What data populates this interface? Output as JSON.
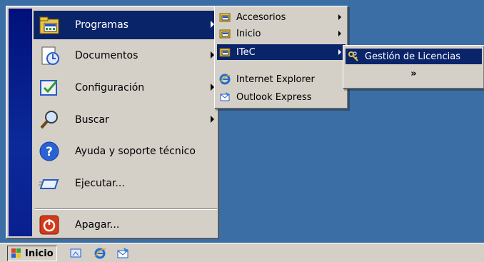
{
  "start_menu": {
    "items": [
      {
        "label": "Programas",
        "icon": "programs-folder-icon",
        "has_submenu": true,
        "selected": true
      },
      {
        "label": "Documentos",
        "icon": "documents-icon",
        "has_submenu": true
      },
      {
        "label": "Configuración",
        "icon": "settings-icon",
        "has_submenu": true
      },
      {
        "label": "Buscar",
        "icon": "search-icon",
        "has_submenu": true
      },
      {
        "label": "Ayuda y soporte técnico",
        "icon": "help-icon",
        "has_submenu": false
      },
      {
        "label": "Ejecutar...",
        "icon": "run-icon",
        "has_submenu": false
      },
      {
        "label": "Apagar...",
        "icon": "shutdown-icon",
        "has_submenu": false
      }
    ]
  },
  "programs_menu": {
    "items": [
      {
        "label": "Accesorios",
        "icon": "program-group-icon",
        "has_submenu": true
      },
      {
        "label": "Inicio",
        "icon": "program-group-icon",
        "has_submenu": true
      },
      {
        "label": "ITeC",
        "icon": "program-group-icon",
        "has_submenu": true,
        "selected": true
      },
      {
        "label": "Internet Explorer",
        "icon": "internet-explorer-icon",
        "has_submenu": false
      },
      {
        "label": "Outlook Express",
        "icon": "outlook-express-icon",
        "has_submenu": false
      }
    ]
  },
  "itec_menu": {
    "items": [
      {
        "label": "Gestión de Licencias",
        "icon": "keys-icon",
        "selected": true
      }
    ],
    "expand_glyph": "»"
  },
  "taskbar": {
    "start_label": "Inicio",
    "quick_launch": [
      "show-desktop-icon",
      "internet-explorer-icon",
      "outlook-express-icon"
    ]
  },
  "colors": {
    "desktop": "#3a6ea5",
    "menu_face": "#d4d0c8",
    "highlight": "#0a246a"
  }
}
